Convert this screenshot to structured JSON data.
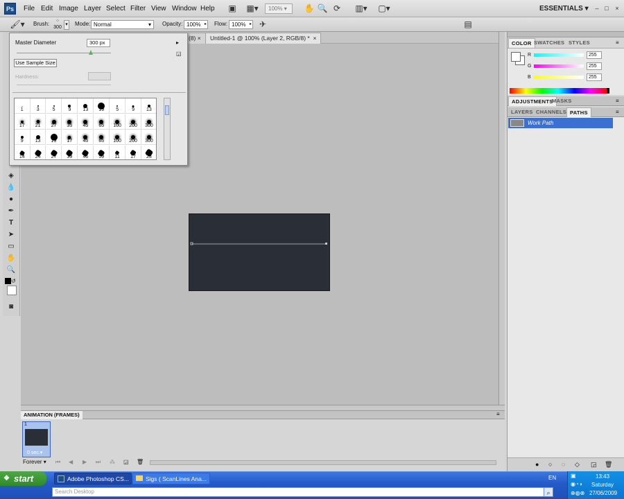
{
  "menubar": {
    "logo": "Ps",
    "items": [
      "File",
      "Edit",
      "Image",
      "Layer",
      "Select",
      "Filter",
      "View",
      "Window",
      "Help"
    ],
    "zoom": "100%",
    "workspace": "ESSENTIALS",
    "win_buttons": [
      "–",
      "□",
      "×"
    ]
  },
  "options": {
    "brush_label": "Brush:",
    "brush_size": "300",
    "mode_label": "Mode:",
    "mode_value": "Normal",
    "opacity_label": "Opacity:",
    "opacity_value": "100%",
    "flow_label": "Flow:",
    "flow_value": "100%"
  },
  "brush_picker": {
    "master_label": "Master Diameter",
    "master_value": "300 px",
    "sample_button": "Use Sample Size",
    "hardness_label": "Hardness:",
    "presets": [
      {
        "n": "1",
        "s": 1
      },
      {
        "n": "3",
        "s": 2
      },
      {
        "n": "5",
        "s": 2
      },
      {
        "n": "9",
        "s": 4
      },
      {
        "n": "13",
        "s": 6
      },
      {
        "n": "19",
        "s": 10
      },
      {
        "n": "5",
        "s": 2
      },
      {
        "n": "9",
        "s": 3
      },
      {
        "n": "13",
        "s": 4
      },
      {
        "n": "17",
        "s": 4
      },
      {
        "n": "21",
        "s": 5
      },
      {
        "n": "27",
        "s": 6
      },
      {
        "n": "35",
        "s": 6
      },
      {
        "n": "45",
        "s": 6
      },
      {
        "n": "65",
        "s": 6
      },
      {
        "n": "100",
        "s": 6
      },
      {
        "n": "200",
        "s": 6
      },
      {
        "n": "300",
        "s": 6
      },
      {
        "n": "9",
        "s": 4
      },
      {
        "n": "13",
        "s": 6
      },
      {
        "n": "19",
        "s": 10
      },
      {
        "n": "17",
        "s": 5
      },
      {
        "n": "45",
        "s": 6
      },
      {
        "n": "65",
        "s": 6
      },
      {
        "n": "100",
        "s": 6
      },
      {
        "n": "200",
        "s": 6
      },
      {
        "n": "300",
        "s": 6
      },
      {
        "n": "14",
        "s": 6
      },
      {
        "n": "24",
        "s": 8
      },
      {
        "n": "27",
        "s": 8
      },
      {
        "n": "39",
        "s": 8
      },
      {
        "n": "46",
        "s": 8
      },
      {
        "n": "59",
        "s": 8
      },
      {
        "n": "11",
        "s": 5
      },
      {
        "n": "17",
        "s": 7
      },
      {
        "n": "23",
        "s": 9
      }
    ]
  },
  "document": {
    "tab_partial": "(8) ×",
    "tab_active": "Untitled-1 @ 100% (Layer 2, RGB/8) *",
    "tab_close": "×"
  },
  "panels": {
    "color_tabs": [
      "COLOR",
      "SWATCHES",
      "STYLES"
    ],
    "rgb": [
      {
        "label": "R",
        "value": "255"
      },
      {
        "label": "G",
        "value": "255"
      },
      {
        "label": "B",
        "value": "255"
      }
    ],
    "adj_tabs": [
      "ADJUSTMENTS",
      "MASKS"
    ],
    "layer_tabs": [
      "LAYERS",
      "CHANNELS",
      "PATHS"
    ],
    "work_path": "Work Path"
  },
  "animation": {
    "title": "ANIMATION (FRAMES)",
    "frame_num": "1",
    "frame_delay": "0 sec.",
    "loop": "Forever"
  },
  "taskbar": {
    "start": "start",
    "tasks": [
      "Adobe Photoshop CS...",
      "Sigs ( ScanLines  Ana..."
    ],
    "lang": "EN",
    "time": "13:43",
    "day": "Saturday",
    "date": "27/06/2009",
    "search_placeholder": "Search Desktop"
  }
}
